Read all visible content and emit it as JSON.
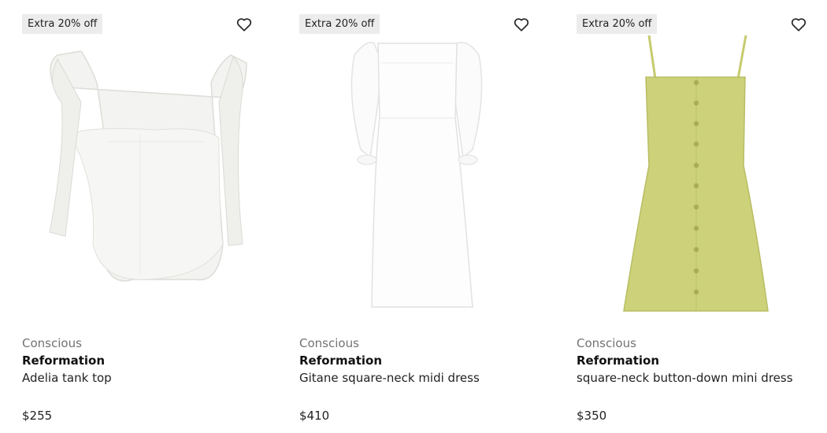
{
  "products": [
    {
      "badge": "Extra 20% off",
      "tag": "Conscious",
      "brand": "Reformation",
      "name": "Adelia tank top",
      "price": "$255",
      "image": "white-tie-strap-tank-top",
      "color": "#f4f4f2"
    },
    {
      "badge": "Extra 20% off",
      "tag": "Conscious",
      "brand": "Reformation",
      "name": "Gitane square-neck midi dress",
      "price": "$410",
      "image": "white-puff-sleeve-midi-dress",
      "color": "#fbfbfb"
    },
    {
      "badge": "Extra 20% off",
      "tag": "Conscious",
      "brand": "Reformation",
      "name": "square-neck button-down mini dress",
      "price": "$350",
      "image": "green-button-down-mini-dress",
      "color": "#cdd27a"
    }
  ],
  "icons": {
    "wishlist": "heart-outline-icon"
  }
}
